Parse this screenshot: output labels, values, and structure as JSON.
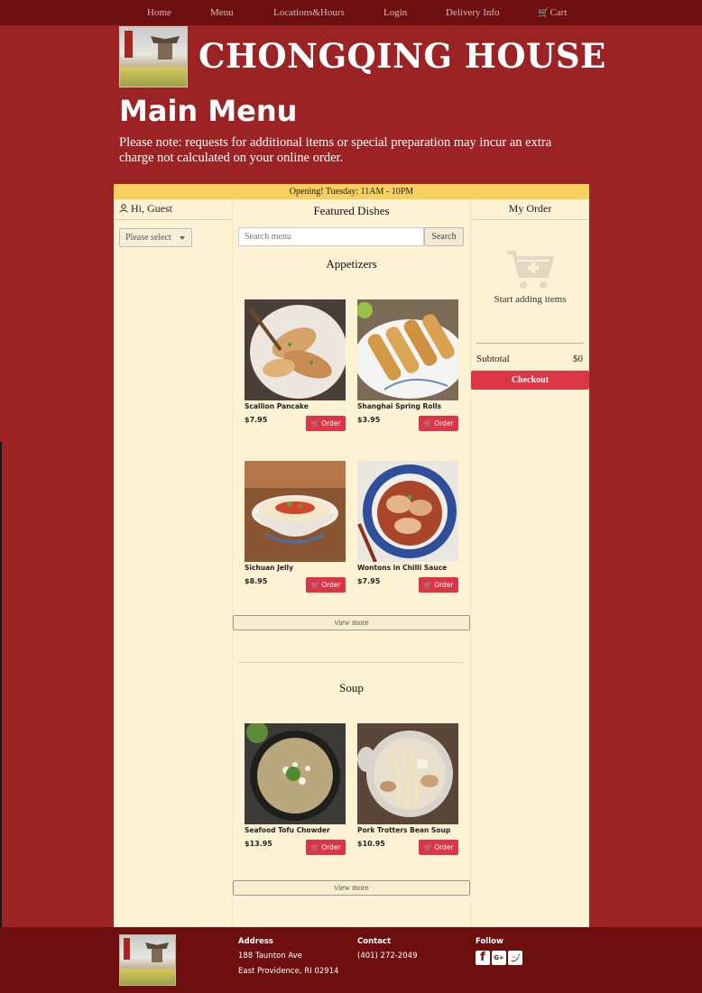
{
  "nav": {
    "home": "Home",
    "menu": "Menu",
    "locations": "Locations&Hours",
    "login": "Login",
    "delivery": "Delivery Info",
    "cart": "Cart"
  },
  "header": {
    "site_title": "CHONGQING HOUSE",
    "page_title": "Main Menu",
    "note": "Please note: requests for additional items or special preparation may incur an extra charge not calculated on your online order."
  },
  "banner": {
    "opening": "Opening! Tuesday: 11AM - 10PM"
  },
  "left": {
    "greeting": "Hi, Guest",
    "select_placeholder": "Please select"
  },
  "center": {
    "featured_title": "Featured Dishes",
    "search_placeholder": "Search menu",
    "search_button": "Search",
    "order_label": "Order",
    "view_more": "view more",
    "sections": [
      {
        "title": "Appetizers",
        "items": [
          {
            "name": "Scallion Pancake",
            "price": "$7.95"
          },
          {
            "name": "Shanghai Spring Rolls",
            "price": "$3.95"
          },
          {
            "name": "Sichuan Jelly",
            "price": "$8.95"
          },
          {
            "name": "Wontons in Chilli Sauce",
            "price": "$7.95"
          }
        ]
      },
      {
        "title": "Soup",
        "items": [
          {
            "name": "Seafood Tofu Chowder",
            "price": "$13.95"
          },
          {
            "name": "Pork Trotters Bean Soup",
            "price": "$10.95"
          }
        ]
      }
    ]
  },
  "order": {
    "title": "My Order",
    "empty_text": "Start adding items",
    "subtotal_label": "Subtotal",
    "subtotal_value": "$0",
    "checkout": "Checkout"
  },
  "footer": {
    "address_heading": "Address",
    "address_line1": "188 Taunton Ave",
    "address_line2": "East Providence, RI 02914",
    "contact_heading": "Contact",
    "phone": "(401) 272-2049",
    "follow_heading": "Follow",
    "social": [
      "facebook-icon",
      "google-plus-icon",
      "twitter-icon"
    ]
  },
  "colors": {
    "background": "#9b2323",
    "nav": "#6e0f0f",
    "panel": "#fdf2d3",
    "banner": "#f6cf5e",
    "accent": "#dc3546"
  }
}
